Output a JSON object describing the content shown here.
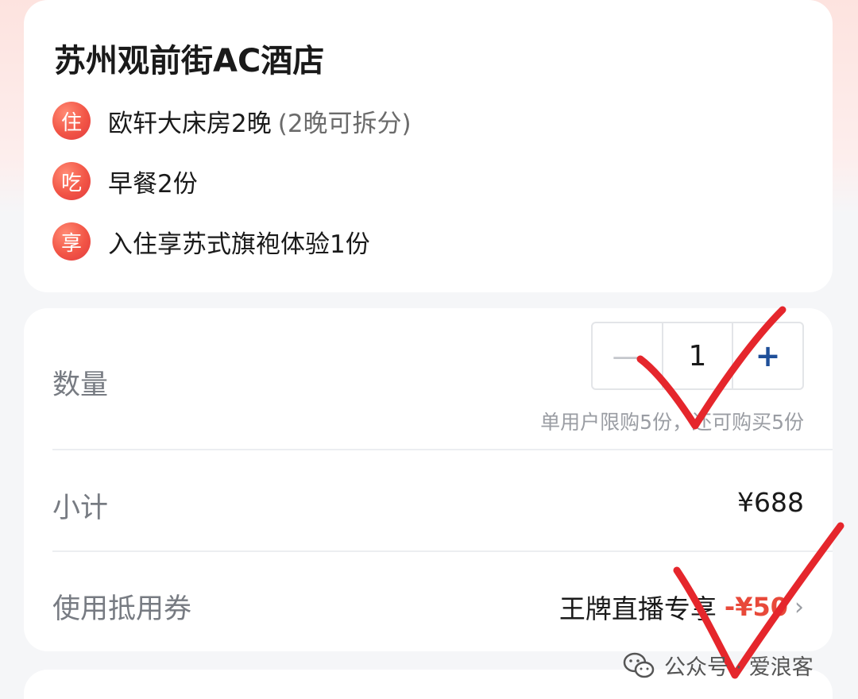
{
  "hotel": {
    "name": "苏州观前街AC酒店",
    "perks": [
      {
        "badge": "住",
        "text": "欧轩大床房2晚",
        "note": "(2晚可拆分)",
        "icon": "stay-badge-icon"
      },
      {
        "badge": "吃",
        "text": "早餐2份",
        "note": "",
        "icon": "meal-badge-icon"
      },
      {
        "badge": "享",
        "text": "入住享苏式旗袍体验1份",
        "note": "",
        "icon": "enjoy-badge-icon"
      }
    ]
  },
  "order": {
    "quantity_label": "数量",
    "quantity_value": "1",
    "minus_symbol": "—",
    "plus_symbol": "+",
    "limit_note": "单用户限购5份，还可购买5份",
    "subtotal_label": "小计",
    "subtotal_value": "¥688",
    "coupon_label": "使用抵用券",
    "coupon_name": "王牌直播专享",
    "coupon_amount": "-¥50",
    "coupon_arrow": "›"
  },
  "watermark": {
    "text": "公众号 · 爱浪客",
    "icon": "wechat-icon"
  },
  "colors": {
    "accent_red": "#e8493a",
    "badge_red": "#f25546",
    "plus_blue": "#1f4f99",
    "check_red": "#e5262c"
  }
}
